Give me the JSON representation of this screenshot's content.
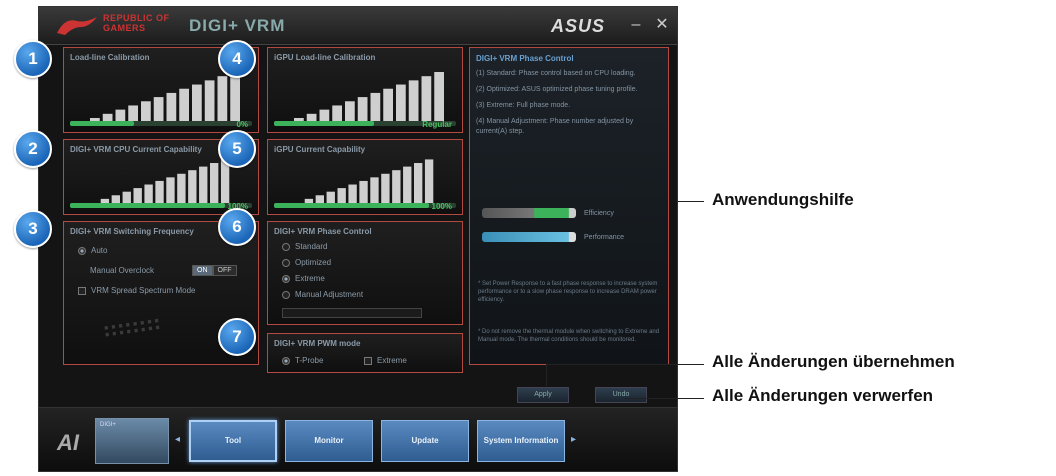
{
  "window": {
    "brand_line1": "REPUBLIC OF",
    "brand_line2": "GAMERS",
    "title": "DIGI+ VRM",
    "vendor": "ASUS",
    "minimize_icon": "minimize-icon",
    "close_icon": "close-icon"
  },
  "panels": [
    {
      "title": "Load-line Calibration",
      "value": "0%",
      "fill": 0.35
    },
    {
      "title": "DIGI+ VRM CPU Current Capability",
      "value": "100%",
      "fill": 0.85
    },
    {
      "title": "DIGI+ VRM Switching Frequency"
    },
    {
      "title": "iGPU Load-line Calibration",
      "value": "Regular",
      "fill": 0.55
    },
    {
      "title": "iGPU Current Capability",
      "value": "100%",
      "fill": 0.85
    },
    {
      "title": "DIGI+ VRM Phase Control"
    },
    {
      "title": "DIGI+ VRM PWM mode"
    }
  ],
  "switching": {
    "auto": "Auto",
    "manual": "Manual Overclock",
    "toggle_on": "ON",
    "toggle_off": "OFF",
    "spread": "VRM Spread Spectrum Mode"
  },
  "phase": {
    "options": [
      "Standard",
      "Optimized",
      "Extreme",
      "Manual Adjustment"
    ],
    "selected": 2
  },
  "pwm": {
    "options": [
      "T-Probe",
      "Extreme"
    ],
    "selected": 0
  },
  "help": {
    "title": "DIGI+ VRM Phase Control",
    "paragraphs": [
      "(1) Standard: Phase control based on CPU loading.",
      "(2) Optimized: ASUS optimized phase tuning profile.",
      "(3) Extreme: Full phase mode.",
      "(4) Manual Adjustment: Phase number adjusted by current(A) step."
    ],
    "efficiency": "Efficiency",
    "performance": "Performance",
    "note1": "* Set Power Response to a fast phase response to increase system performance or to a slow phase response to increase DRAM power efficiency.",
    "note2": "* Do not remove the thermal module when switching to Extreme and Manual mode. The thermal conditions should be monitored."
  },
  "actions": {
    "apply": "Apply",
    "undo": "Undo"
  },
  "nav": {
    "logo": "AI",
    "thumb_label": "DIGI+",
    "tabs": [
      "Tool",
      "Monitor",
      "Update",
      "System Information"
    ],
    "active": 0
  },
  "badges": [
    "1",
    "2",
    "3",
    "4",
    "5",
    "6",
    "7"
  ],
  "callouts": {
    "help": "Anwendungshilfe",
    "apply": "Alle Änderungen übernehmen",
    "undo": "Alle Änderungen verwerfen"
  },
  "colors": {
    "accent_red": "#b24a42",
    "bar_green": "#3cb35a",
    "nav_blue": "#3f72ab"
  }
}
